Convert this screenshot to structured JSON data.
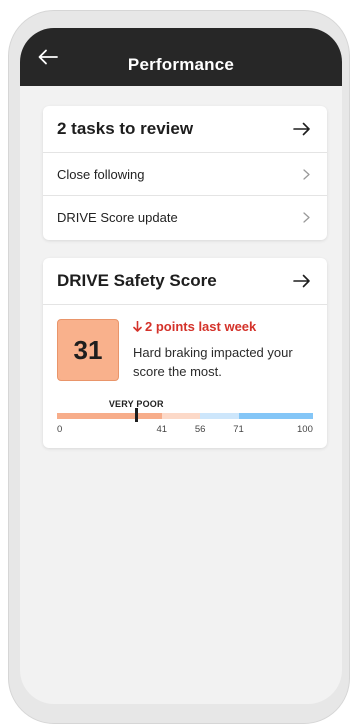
{
  "header": {
    "title": "Performance"
  },
  "tasks_card": {
    "title": "2 tasks to review",
    "items": [
      {
        "label": "Close following"
      },
      {
        "label": "DRIVE Score update"
      }
    ]
  },
  "safety_card": {
    "title": "DRIVE Safety Score",
    "score": "31",
    "delta_text": "2 points last week",
    "description": "Hard braking impacted your score the most.",
    "rating_label": "VERY POOR",
    "scale_ticks": [
      "0",
      "41",
      "56",
      "71",
      "100"
    ],
    "score_value": 31,
    "segments": [
      {
        "from": 0,
        "to": 41,
        "color": "#f7ad8a"
      },
      {
        "from": 41,
        "to": 56,
        "color": "#fcd9c8"
      },
      {
        "from": 56,
        "to": 71,
        "color": "#cde6fb"
      },
      {
        "from": 71,
        "to": 100,
        "color": "#84c6f7"
      }
    ]
  },
  "colors": {
    "header_bg": "#272727",
    "alert_red": "#d4322a",
    "score_box": "#f9b18c"
  }
}
